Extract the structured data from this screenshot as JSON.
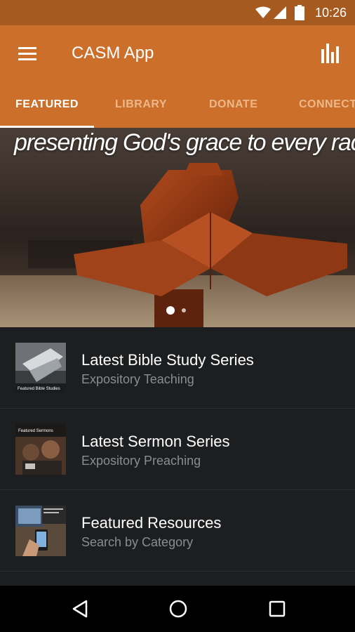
{
  "status_bar": {
    "time": "10:26"
  },
  "app_bar": {
    "title": "CASM App"
  },
  "tabs": [
    {
      "label": "FEATURED",
      "active": true
    },
    {
      "label": "LIBRARY",
      "active": false
    },
    {
      "label": "DONATE",
      "active": false
    },
    {
      "label": "CONNECT",
      "active": false
    }
  ],
  "hero": {
    "caption": "presenting God's grace to every race",
    "pages": 2,
    "current_page": 1
  },
  "list": [
    {
      "title": "Latest Bible Study Series",
      "subtitle": "Expository Teaching",
      "thumb_text": "Featured Bible Studies"
    },
    {
      "title": "Latest Sermon Series",
      "subtitle": "Expository Preaching",
      "thumb_text": "Featured Sermons"
    },
    {
      "title": "Featured Resources",
      "subtitle": "Search by Category",
      "thumb_text": ""
    }
  ],
  "icons": [
    "wifi-icon",
    "signal-icon",
    "battery-icon",
    "menu-icon",
    "stats-icon",
    "back-icon",
    "home-icon",
    "recents-icon"
  ],
  "colors": {
    "app_bar": "#cc6f2a",
    "status_bar": "#a75a1f",
    "background": "#1d1e20",
    "subtitle": "#8a8c8e"
  }
}
